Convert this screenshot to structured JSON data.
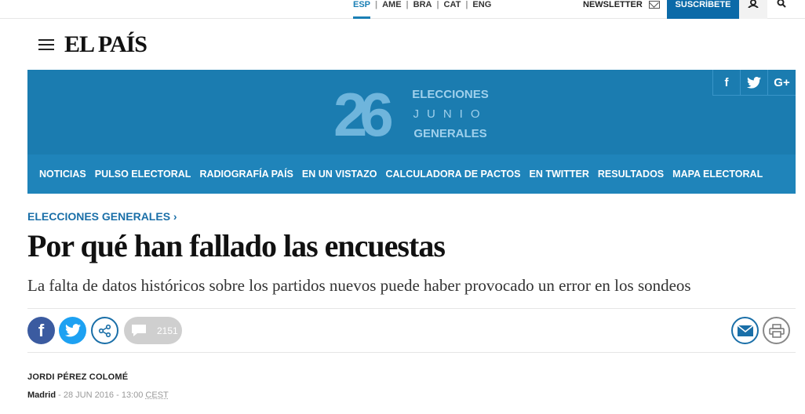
{
  "topbar": {
    "languages": [
      {
        "label": "ESP",
        "active": true
      },
      {
        "label": "AME",
        "active": false
      },
      {
        "label": "BRA",
        "active": false
      },
      {
        "label": "CAT",
        "active": false
      },
      {
        "label": "ENG",
        "active": false
      }
    ],
    "separator": "|",
    "newsletter_label": "NEWSLETTER",
    "subscribe_label": "SUSCRÍBETE",
    "icons": {
      "newsletter": "mail-icon",
      "user": "user-icon",
      "search": "search-icon"
    }
  },
  "header": {
    "logo_text": "EL PAÍS",
    "menu_icon": "hamburger-menu-icon"
  },
  "banner": {
    "number": "26",
    "lines": [
      "ELECCIONES",
      "JUNIO",
      "GENERALES"
    ],
    "social": [
      {
        "label": "f",
        "icon": "facebook-icon"
      },
      {
        "label": "",
        "icon": "twitter-icon"
      },
      {
        "label": "G+",
        "icon": "google-plus-icon"
      }
    ],
    "nav": [
      "NOTICIAS",
      "PULSO ELECTORAL",
      "RADIOGRAFÍA PAÍS",
      "EN UN VISTAZO",
      "CALCULADORA DE PACTOS",
      "EN TWITTER",
      "RESULTADOS",
      "MAPA ELECTORAL"
    ],
    "colors": {
      "background": "#1b7cb0",
      "nav_background": "#1f84ba",
      "numeral": "#6fb5dc"
    }
  },
  "article": {
    "section": "ELECCIONES GENERALES",
    "section_chevron": "›",
    "headline": "Por qué han fallado las encuestas",
    "subtitle": "La falta de datos históricos sobre los partidos nuevos puede haber provocado un error en los sondeos",
    "share": {
      "facebook": "f",
      "comment_count": "2151"
    },
    "author": "JORDI PÉREZ COLOMÉ",
    "city": "Madrid",
    "date": "- 28 JUN 2016 - 13:00",
    "timezone": "CEST"
  }
}
